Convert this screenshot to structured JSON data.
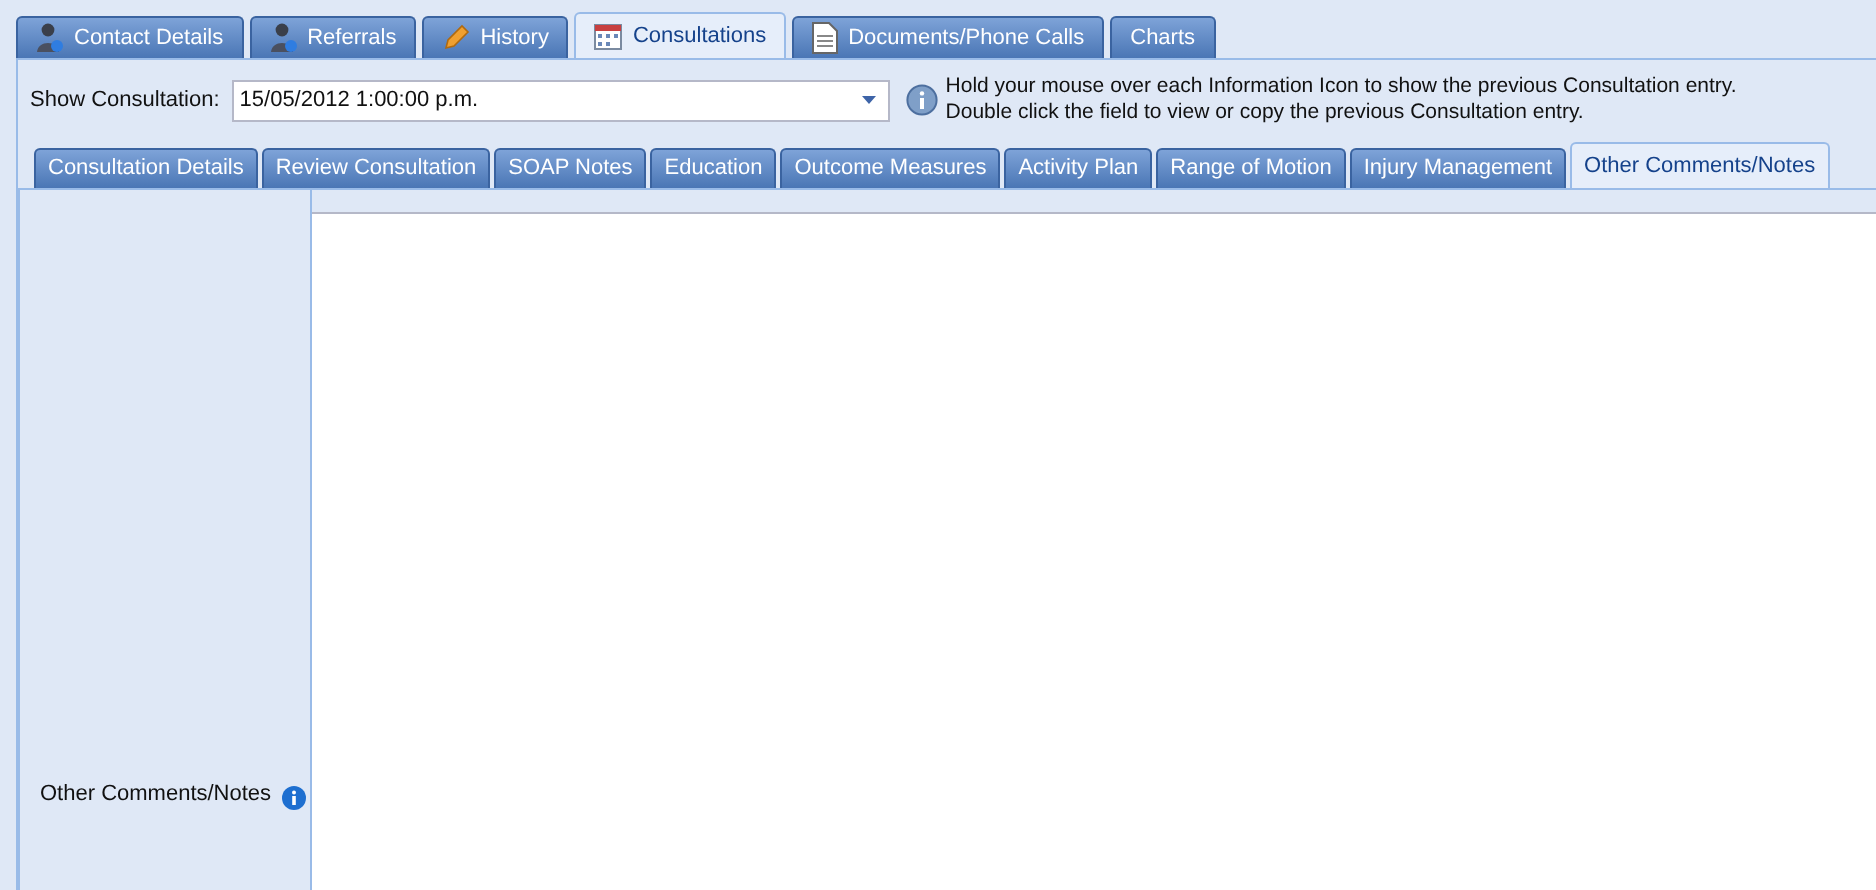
{
  "main_tabs": [
    {
      "label": "Contact Details",
      "selected": false
    },
    {
      "label": "Referrals",
      "selected": false
    },
    {
      "label": "History",
      "selected": false
    },
    {
      "label": "Consultations",
      "selected": true
    },
    {
      "label": "Documents/Phone Calls",
      "selected": false
    },
    {
      "label": "Charts",
      "selected": false
    }
  ],
  "show_consultation": {
    "label": "Show Consultation:",
    "value": "15/05/2012 1:00:00 p.m."
  },
  "info_note": [
    "Hold your mouse over each Information Icon to show the previous Consultation entry.",
    "Double click the field to view or copy the previous Consultation entry."
  ],
  "sub_tabs": [
    {
      "label": "Consultation Details",
      "selected": false
    },
    {
      "label": "Review Consultation",
      "selected": false
    },
    {
      "label": "SOAP Notes",
      "selected": false
    },
    {
      "label": "Education",
      "selected": false
    },
    {
      "label": "Outcome Measures",
      "selected": false
    },
    {
      "label": "Activity Plan",
      "selected": false
    },
    {
      "label": "Range of Motion",
      "selected": false
    },
    {
      "label": "Injury Management",
      "selected": false
    },
    {
      "label": "Other Comments/Notes",
      "selected": true
    }
  ],
  "field": {
    "label": "Other Comments/Notes"
  }
}
